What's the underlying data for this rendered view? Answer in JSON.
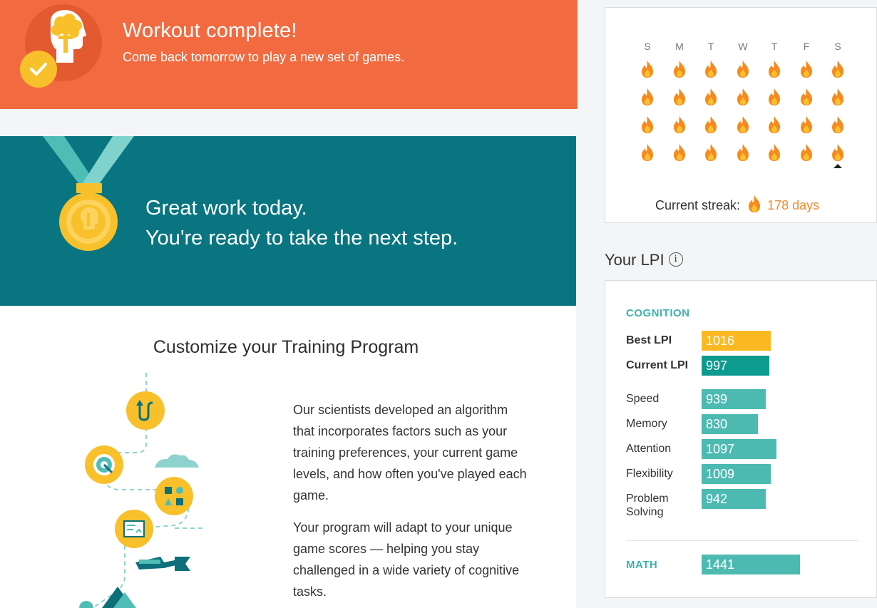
{
  "banner": {
    "title": "Workout complete!",
    "subtitle": "Come back tomorrow to play a new set of games."
  },
  "great": {
    "line1": "Great work today.",
    "line2": "You're ready to take the next step."
  },
  "customize": {
    "title": "Customize your Training Program",
    "para1_lines": [
      "Our scientists developed an algorithm",
      "that incorporates factors such as your",
      "training preferences, your current game",
      "levels, and how often you've played each",
      "game."
    ],
    "para2_lines": [
      "Your program will adapt to your unique",
      "game scores — helping you stay",
      "challenged in a wide variety of cognitive",
      "tasks."
    ]
  },
  "streak": {
    "days": [
      "S",
      "M",
      "T",
      "W",
      "T",
      "F",
      "S"
    ],
    "weeks": 4,
    "label": "Current streak:",
    "value": "178 days",
    "flame_color": "#f58a1f"
  },
  "lpi": {
    "title": "Your LPI",
    "info_icon": "i",
    "cognition_label": "COGNITION",
    "best_label": "Best LPI",
    "best_value": "1016",
    "current_label": "Current LPI",
    "current_value": "997",
    "items": [
      {
        "label": "Speed",
        "value": "939"
      },
      {
        "label": "Memory",
        "value": "830"
      },
      {
        "label": "Attention",
        "value": "1097"
      },
      {
        "label": "Flexibility",
        "value": "1009"
      },
      {
        "label": "Problem",
        "label2": "Solving",
        "value": "942"
      }
    ],
    "math_label": "MATH",
    "math_value": "1441",
    "colors": {
      "best": "#fbb921",
      "current": "#0c9b8e",
      "item": "#4dbab2",
      "section": "#3fb3ac"
    }
  },
  "colors": {
    "banner": "#f26b40",
    "great": "#087580",
    "accent_yellow": "#f8c12c"
  }
}
